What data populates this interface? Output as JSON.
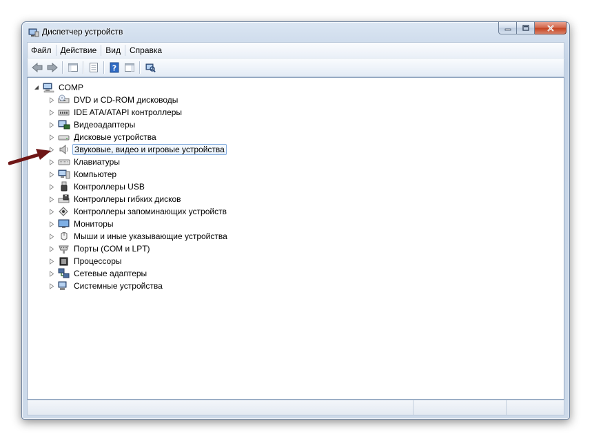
{
  "window": {
    "title": "Диспетчер устройств"
  },
  "menu": [
    {
      "label": "Файл"
    },
    {
      "label": "Действие"
    },
    {
      "label": "Вид"
    },
    {
      "label": "Справка"
    }
  ],
  "toolbar": {
    "buttons": [
      "back-icon",
      "forward-icon",
      "show-hide-console-tree-icon",
      "properties-icon",
      "help-icon",
      "action-pane-icon",
      "scan-hardware-icon"
    ]
  },
  "tree": {
    "root": {
      "label": "COMP",
      "icon": "computer-icon"
    },
    "categories": [
      {
        "label": "DVD и CD-ROM дисководы",
        "icon": "dvd-drive-icon"
      },
      {
        "label": "IDE ATA/ATAPI контроллеры",
        "icon": "ide-controller-icon"
      },
      {
        "label": "Видеоадаптеры",
        "icon": "display-adapter-icon"
      },
      {
        "label": "Дисковые устройства",
        "icon": "disk-drive-icon"
      },
      {
        "label": "Звуковые, видео и игровые устройства",
        "icon": "speaker-icon",
        "selected": true
      },
      {
        "label": "Клавиатуры",
        "icon": "keyboard-icon"
      },
      {
        "label": "Компьютер",
        "icon": "computer-icon"
      },
      {
        "label": "Контроллеры USB",
        "icon": "usb-icon"
      },
      {
        "label": "Контроллеры гибких дисков",
        "icon": "floppy-controller-icon"
      },
      {
        "label": "Контроллеры запоминающих устройств",
        "icon": "storage-controller-icon"
      },
      {
        "label": "Мониторы",
        "icon": "monitor-icon"
      },
      {
        "label": "Мыши и иные указывающие устройства",
        "icon": "mouse-icon"
      },
      {
        "label": "Порты (COM и LPT)",
        "icon": "port-icon"
      },
      {
        "label": "Процессоры",
        "icon": "processor-icon"
      },
      {
        "label": "Сетевые адаптеры",
        "icon": "network-adapter-icon"
      },
      {
        "label": "Системные устройства",
        "icon": "system-device-icon"
      }
    ]
  },
  "colors": {
    "annotation_arrow": "#7a1a1a",
    "selection_border": "#84acdd"
  }
}
